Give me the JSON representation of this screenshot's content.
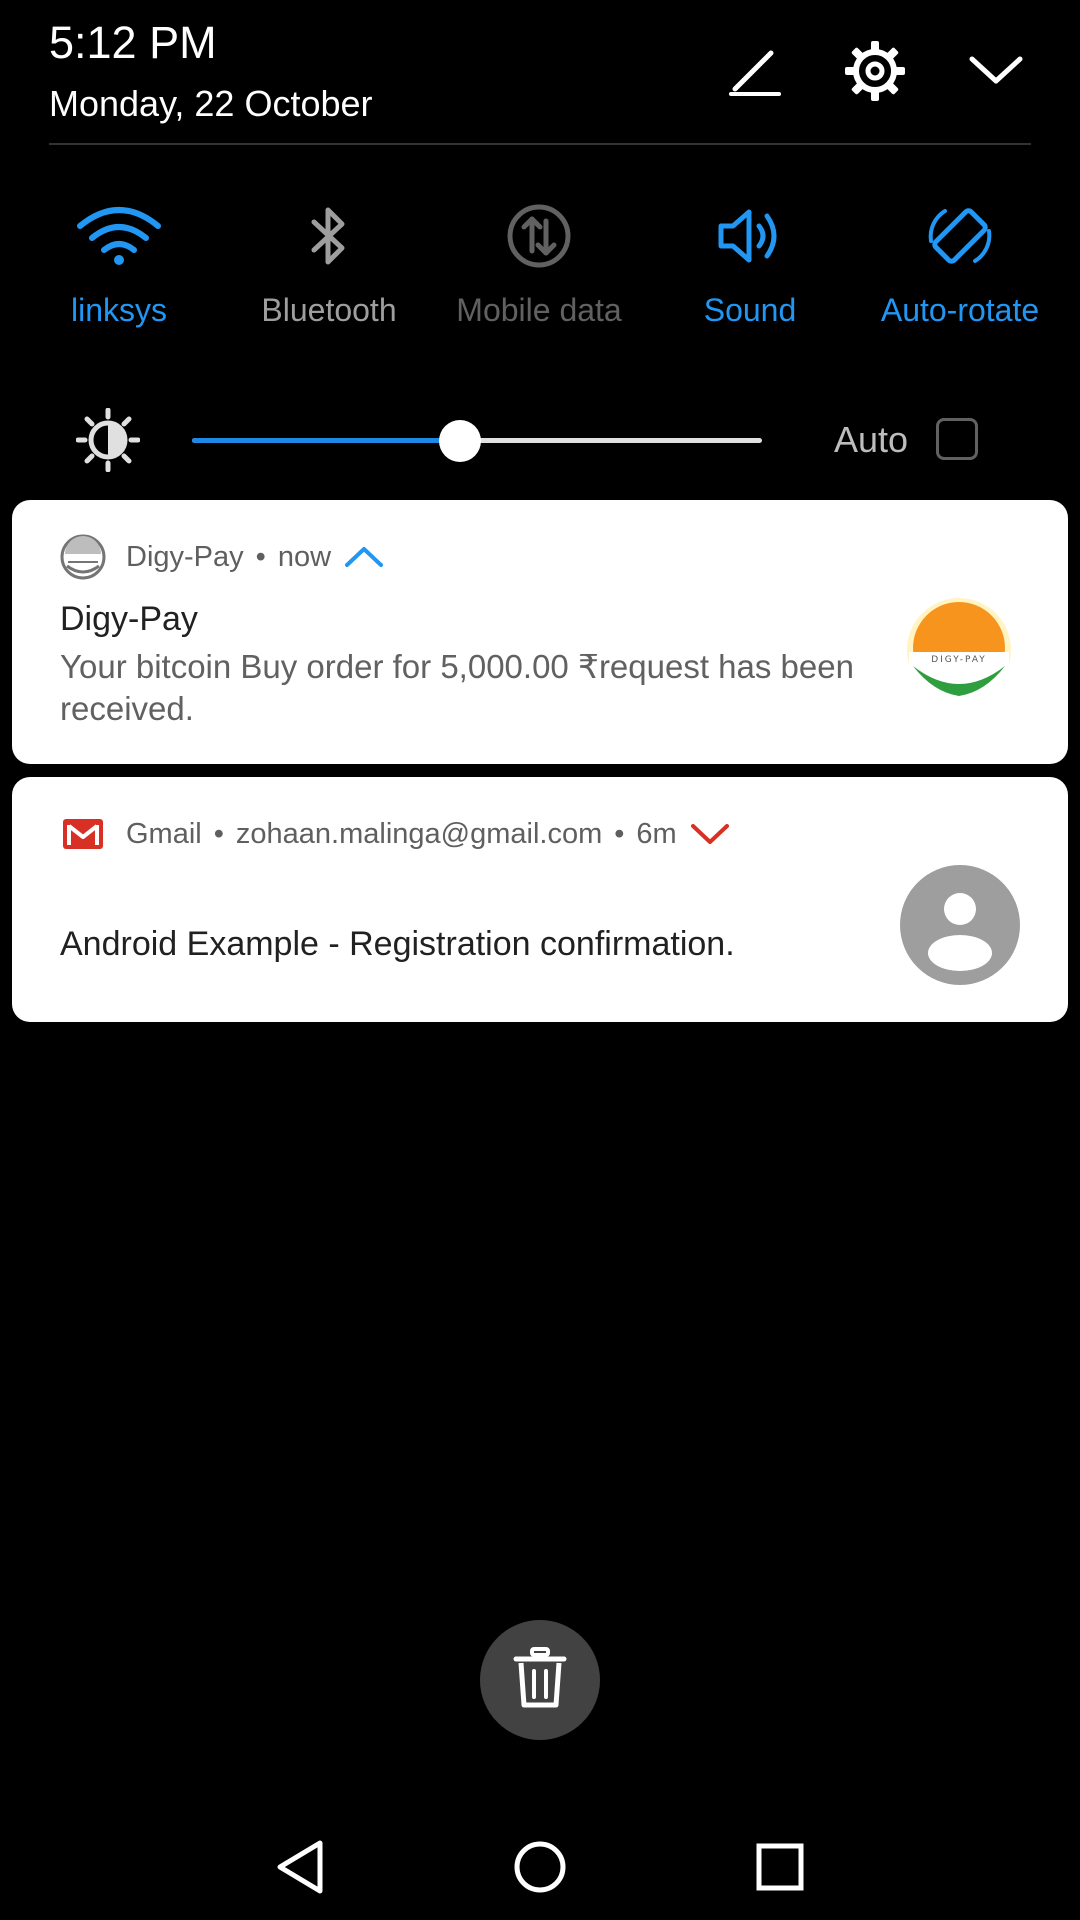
{
  "header": {
    "time": "5:12 PM",
    "date": "Monday, 22 October",
    "icons": [
      "edit-icon",
      "settings-icon",
      "collapse-chevron-icon"
    ]
  },
  "toggles": [
    {
      "label": "linksys",
      "icon": "wifi-icon",
      "state": "on"
    },
    {
      "label": "Bluetooth",
      "icon": "bluetooth-icon",
      "state": "off"
    },
    {
      "label": "Mobile data",
      "icon": "mobile-data-icon",
      "state": "disabled"
    },
    {
      "label": "Sound",
      "icon": "sound-icon",
      "state": "on"
    },
    {
      "label": "Auto-rotate",
      "icon": "auto-rotate-icon",
      "state": "on"
    }
  ],
  "brightness": {
    "level": 0.47,
    "auto_label": "Auto",
    "auto_checked": false
  },
  "notifications": [
    {
      "app": "Digy-Pay",
      "time": "now",
      "title": "Digy-Pay",
      "text": "Your bitcoin Buy order for 5,000.00 ₹request has been received.",
      "logo_text": "DIGY-PAY",
      "expanded": true
    },
    {
      "app": "Gmail",
      "account": "zohaan.malinga@gmail.com",
      "time": "6m",
      "text": "Android Example - Registration confirmation.",
      "expanded": false
    }
  ],
  "colors": {
    "accent": "#2196f3",
    "gmail_red": "#d93025",
    "digy_orange": "#f7941d",
    "digy_green": "#2e9e3e"
  }
}
